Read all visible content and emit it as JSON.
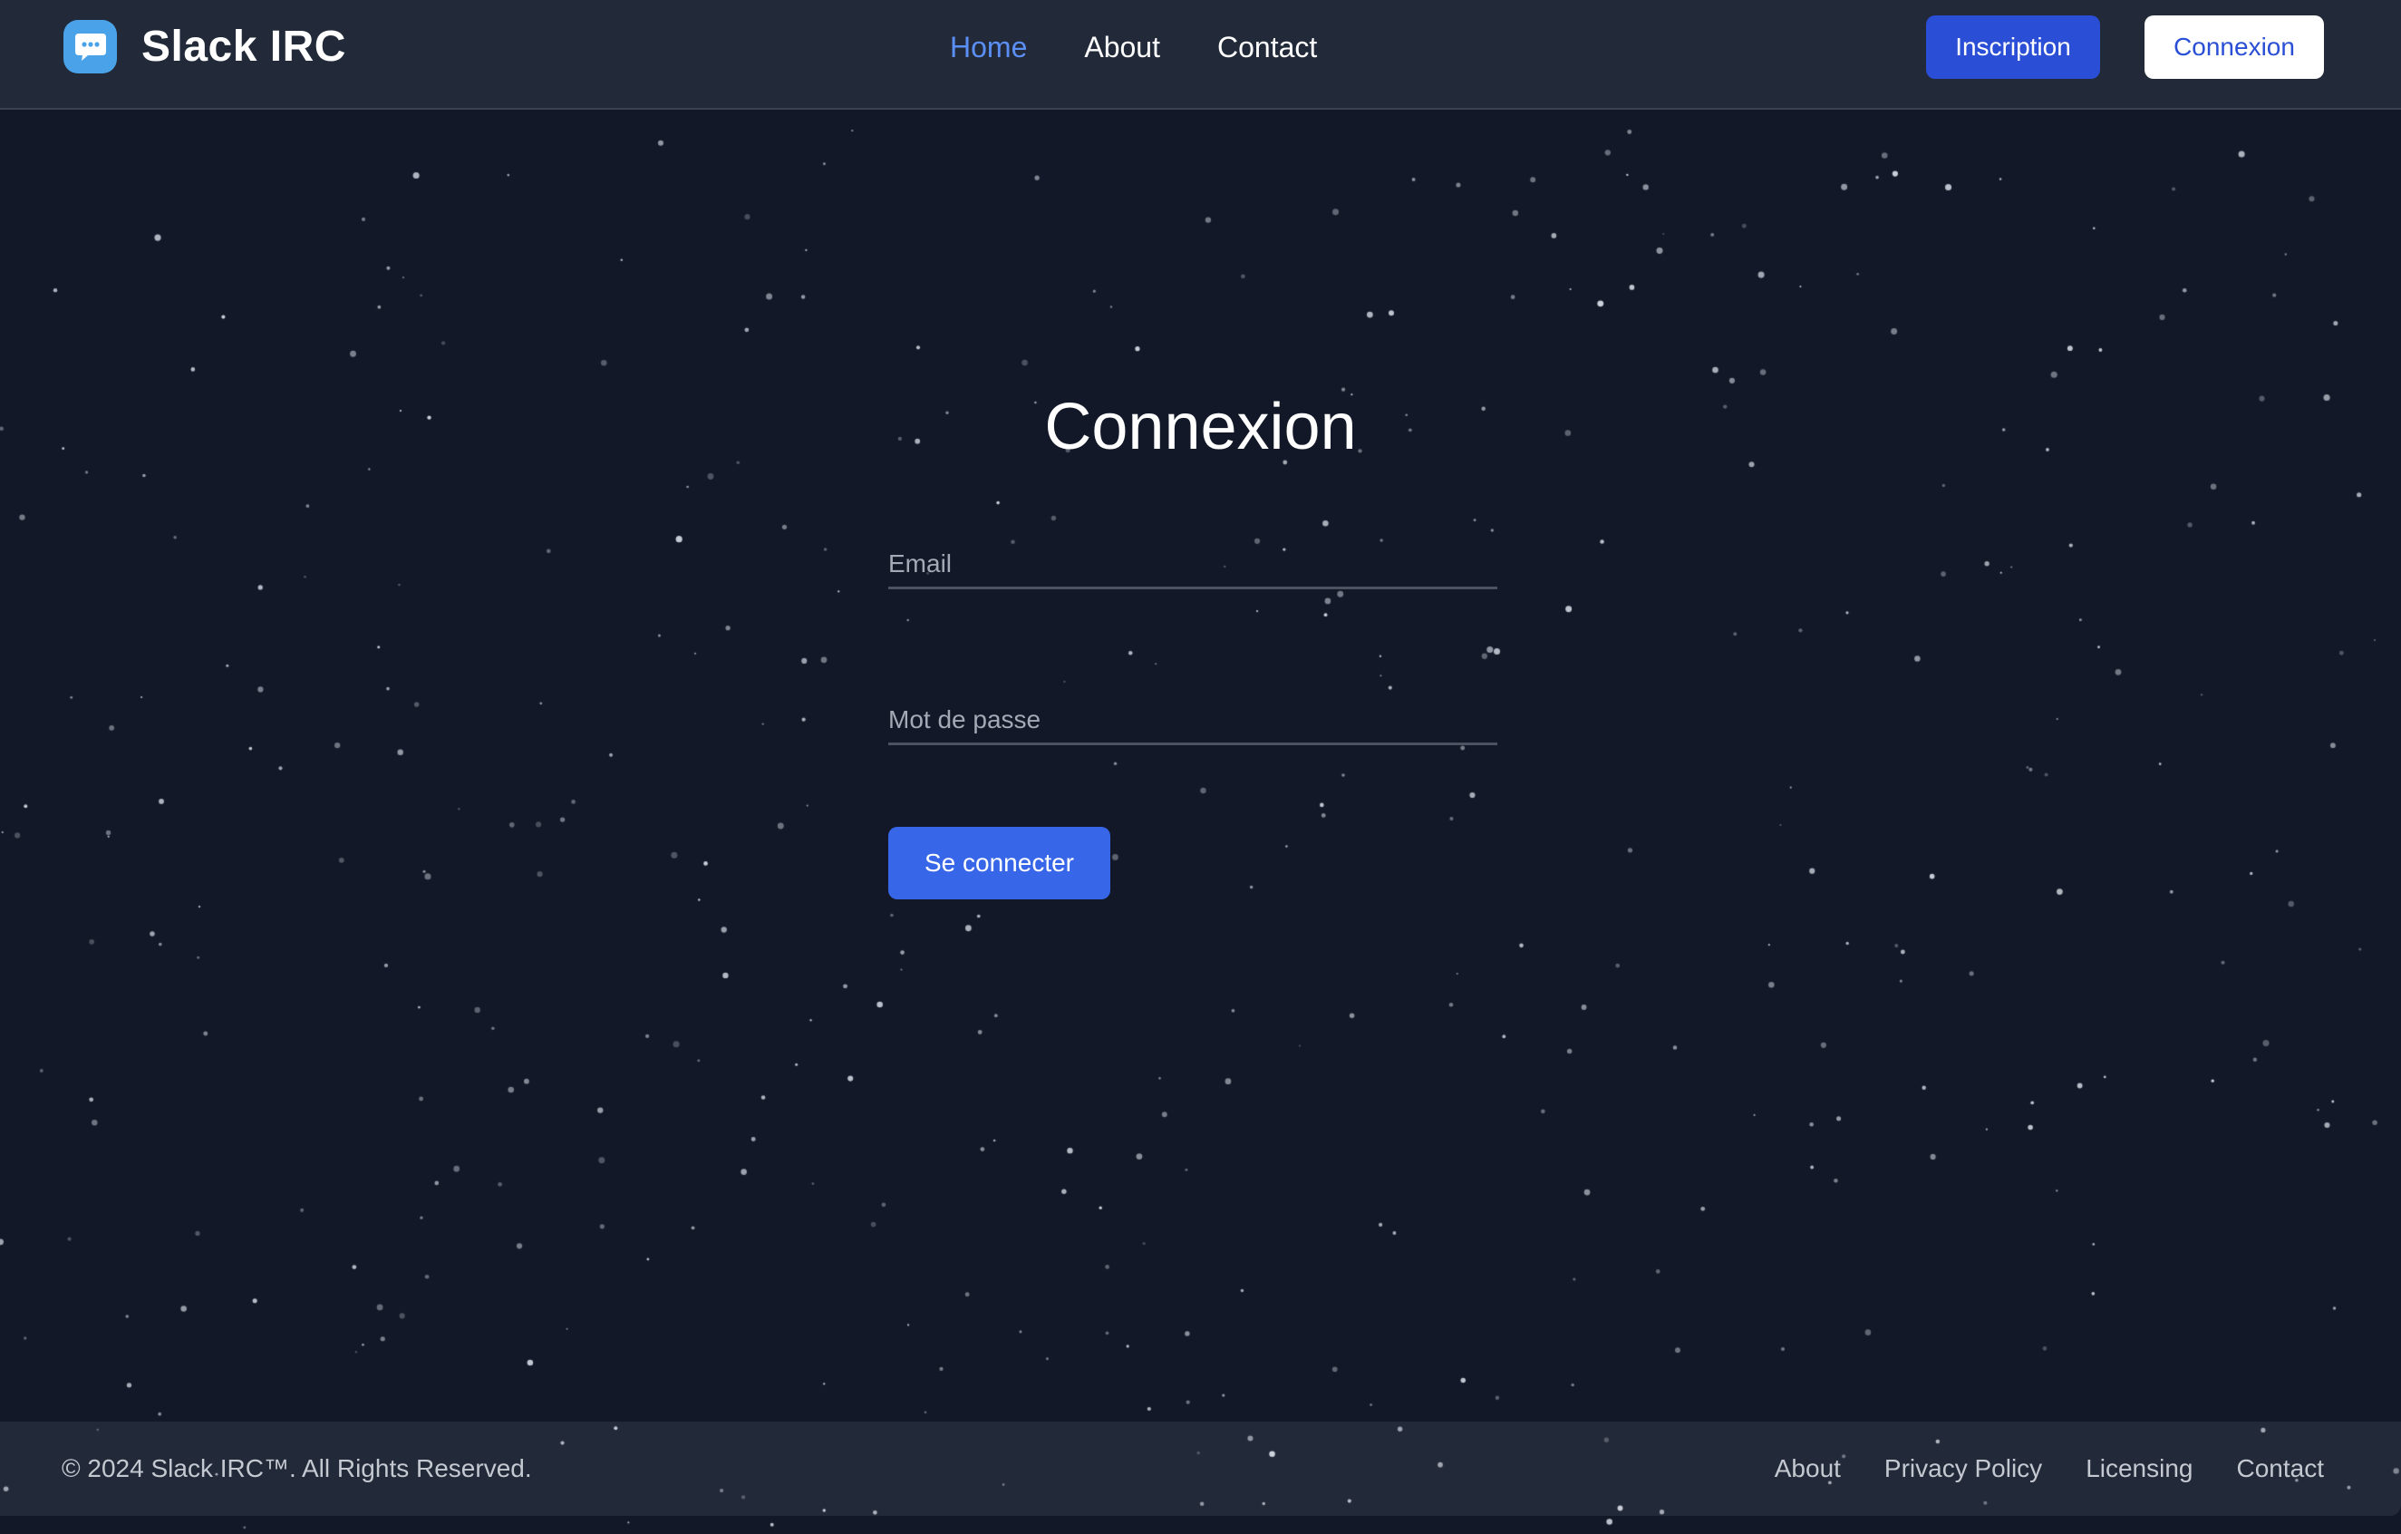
{
  "app": {
    "name": "Slack IRC",
    "logo_icon": "chat-bubble-icon",
    "accent_color": "#2a4fd6",
    "background_color": "#121827"
  },
  "header": {
    "nav": [
      {
        "label": "Home",
        "active": true
      },
      {
        "label": "About",
        "active": false
      },
      {
        "label": "Contact",
        "active": false
      }
    ],
    "signup_label": "Inscription",
    "login_label": "Connexion"
  },
  "form": {
    "title": "Connexion",
    "email_placeholder": "Email",
    "email_value": "",
    "password_placeholder": "Mot de passe",
    "password_value": "",
    "submit_label": "Se connecter"
  },
  "footer": {
    "copyright": "© 2024 Slack IRC™. All Rights Reserved.",
    "links": [
      {
        "label": "About"
      },
      {
        "label": "Privacy Policy"
      },
      {
        "label": "Licensing"
      },
      {
        "label": "Contact"
      }
    ]
  }
}
